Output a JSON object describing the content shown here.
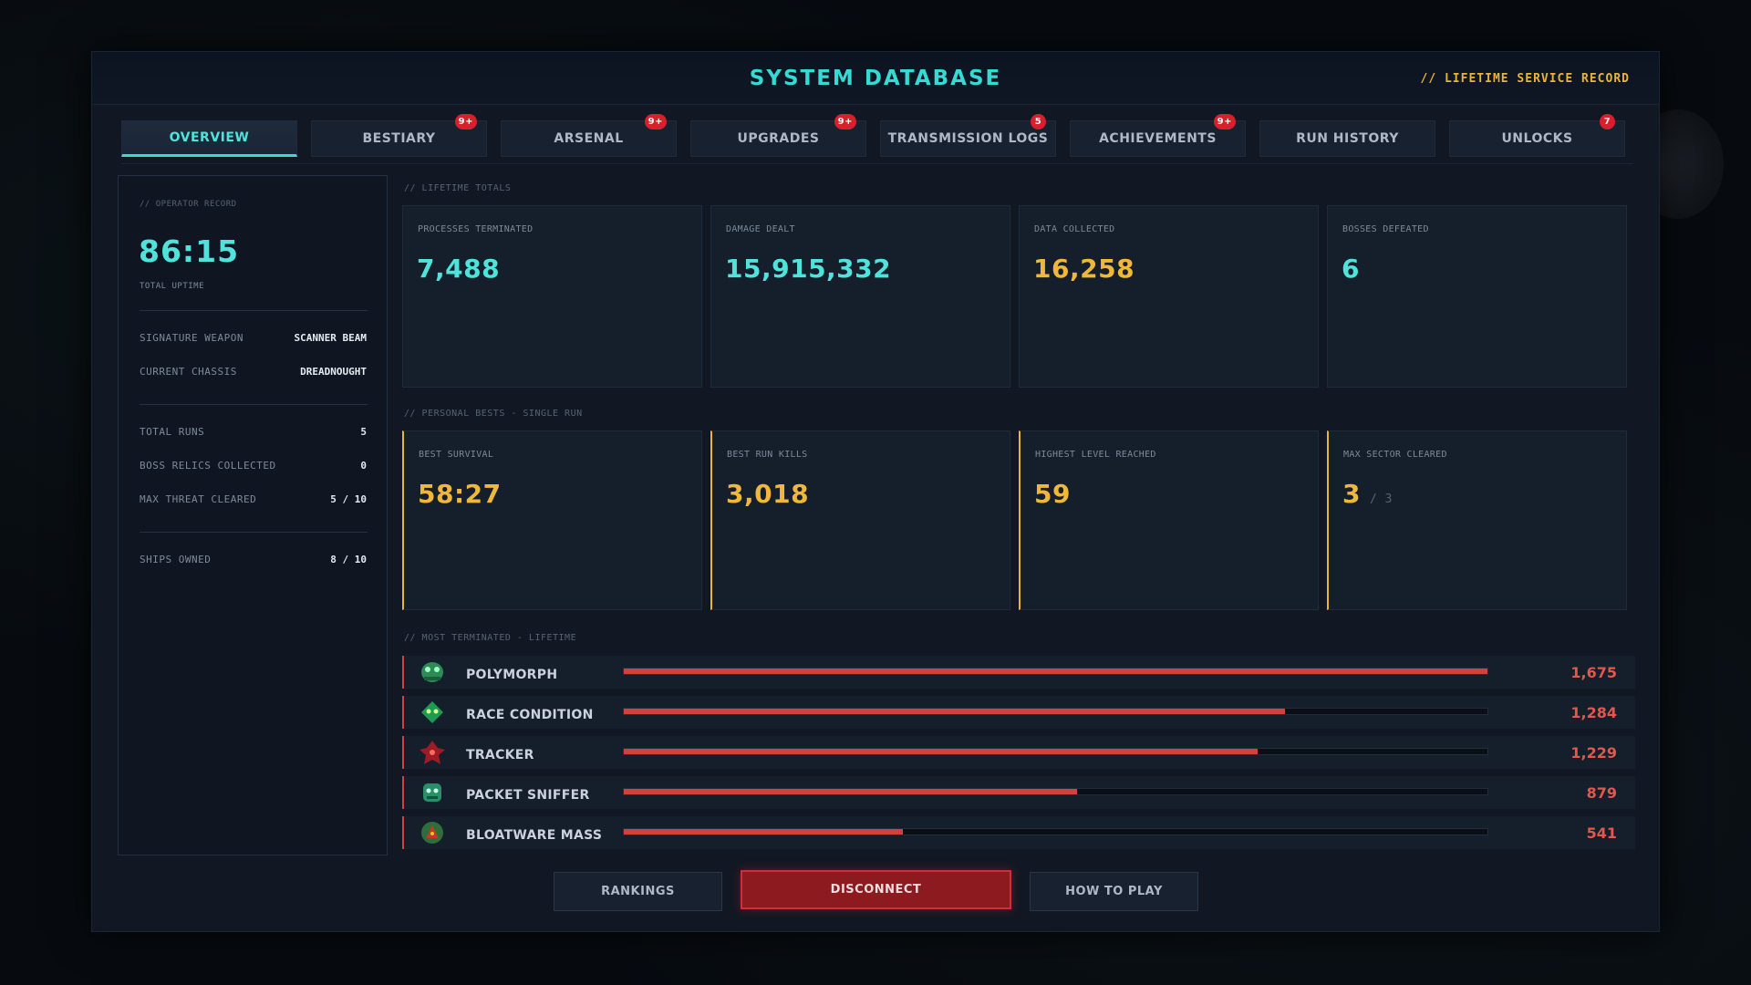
{
  "header": {
    "title": "SYSTEM DATABASE",
    "subtitle": "// LIFETIME SERVICE RECORD"
  },
  "tabs": [
    {
      "label": "OVERVIEW",
      "badge": "",
      "active": true
    },
    {
      "label": "BESTIARY",
      "badge": "9+"
    },
    {
      "label": "ARSENAL",
      "badge": "9+"
    },
    {
      "label": "UPGRADES",
      "badge": "9+"
    },
    {
      "label": "TRANSMISSION LOGS",
      "badge": "5"
    },
    {
      "label": "ACHIEVEMENTS",
      "badge": "9+"
    },
    {
      "label": "RUN HISTORY",
      "badge": ""
    },
    {
      "label": "UNLOCKS",
      "badge": "7"
    }
  ],
  "operator": {
    "section": "// OPERATOR RECORD",
    "uptime": "86:15",
    "uptime_label": "TOTAL UPTIME",
    "rows": [
      {
        "label": "SIGNATURE WEAPON",
        "value": "SCANNER BEAM"
      },
      {
        "label": "CURRENT CHASSIS",
        "value": "DREADNOUGHT"
      },
      {
        "label": "TOTAL RUNS",
        "value": "5"
      },
      {
        "label": "BOSS RELICS COLLECTED",
        "value": "0"
      },
      {
        "label": "MAX THREAT CLEARED",
        "value": "5 / 10"
      },
      {
        "label": "SHIPS OWNED",
        "value": "8 / 10"
      }
    ]
  },
  "lifetime": {
    "section": "// LIFETIME TOTALS",
    "cards": [
      {
        "label": "PROCESSES TERMINATED",
        "value": "7,488",
        "color": "#4fe3dc"
      },
      {
        "label": "DAMAGE DEALT",
        "value": "15,915,332",
        "color": "#4fe3dc"
      },
      {
        "label": "DATA COLLECTED",
        "value": "16,258",
        "color": "#f0b83a"
      },
      {
        "label": "BOSSES DEFEATED",
        "value": "6",
        "color": "#4fe3dc"
      }
    ]
  },
  "bests": {
    "section": "// PERSONAL BESTS - SINGLE RUN",
    "cards": [
      {
        "label": "BEST SURVIVAL",
        "value": "58:27",
        "sub": ""
      },
      {
        "label": "BEST RUN KILLS",
        "value": "3,018",
        "sub": ""
      },
      {
        "label": "HIGHEST LEVEL REACHED",
        "value": "59",
        "sub": ""
      },
      {
        "label": "MAX SECTOR CLEARED",
        "value": "3",
        "sub": "/ 3"
      }
    ]
  },
  "most_terminated": {
    "section": "// MOST TERMINATED - LIFETIME",
    "rows": [
      {
        "name": "POLYMORPH",
        "count": "1,675",
        "fraction": 1.0,
        "icon": "polymorph-icon"
      },
      {
        "name": "RACE CONDITION",
        "count": "1,284",
        "fraction": 0.766,
        "icon": "race-condition-icon"
      },
      {
        "name": "TRACKER",
        "count": "1,229",
        "fraction": 0.734,
        "icon": "tracker-icon"
      },
      {
        "name": "PACKET SNIFFER",
        "count": "879",
        "fraction": 0.525,
        "icon": "packet-sniffer-icon"
      },
      {
        "name": "BLOATWARE MASS",
        "count": "541",
        "fraction": 0.323,
        "icon": "bloatware-mass-icon"
      }
    ]
  },
  "buttons": {
    "rankings": "RANKINGS",
    "disconnect": "DISCONNECT",
    "how_to_play": "HOW TO PLAY"
  },
  "colors": {
    "accent": "#36d9d4",
    "gold": "#e8b43a",
    "danger": "#d0423b"
  }
}
